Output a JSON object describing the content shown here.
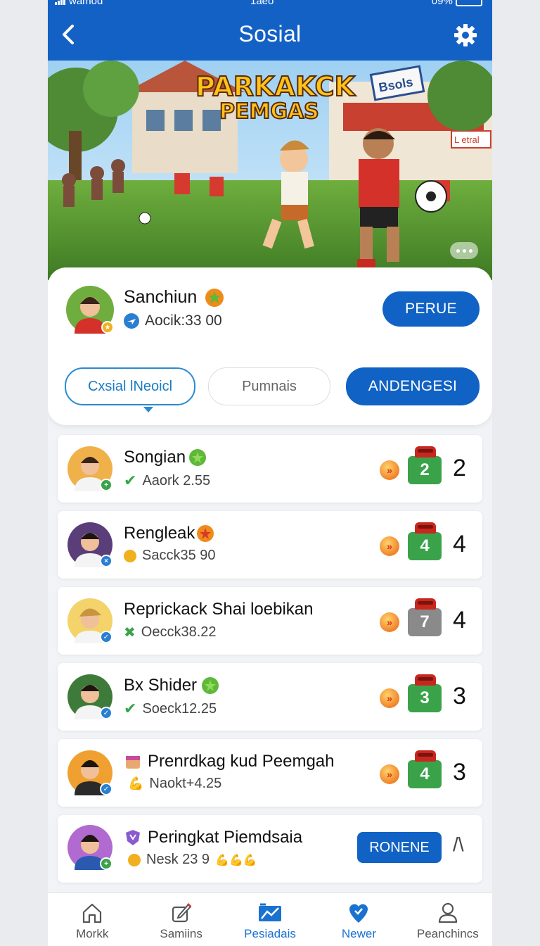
{
  "status_bar": {
    "carrier": "wamod",
    "time": "1aeo",
    "battery": "09%"
  },
  "header": {
    "title": "Sosial"
  },
  "banner": {
    "logo_line1": "PARKAKCK",
    "logo_line2": "PEMGAS",
    "sign_text": "Bsols",
    "side_sign": "L etral"
  },
  "profile": {
    "name": "Sanchiun",
    "sub_label": "Aocik:33 00",
    "action_button": "PERUE"
  },
  "tabs": [
    {
      "label": "Cxsial lNeoicl",
      "state": "selected-outline"
    },
    {
      "label": "Pumnais",
      "state": "default"
    },
    {
      "label": "ANDENGESI",
      "state": "active"
    }
  ],
  "list": [
    {
      "name": "Songian",
      "badge": "green",
      "sub": "Aaork 2.55",
      "sub_icon": "check",
      "score": "2",
      "score_color": "#3aa34a",
      "rank": "2"
    },
    {
      "name": "Rengleak",
      "badge": "orange",
      "sub": "Sacck35 90",
      "sub_icon": "coin",
      "score": "4",
      "score_color": "#3aa34a",
      "rank": "4"
    },
    {
      "name": "Reprickack Shai loebikan",
      "badge": "",
      "sub": "Oecck38.22",
      "sub_icon": "star",
      "score": "7",
      "score_color": "#8a8a8a",
      "rank": "4"
    },
    {
      "name": "Bx Shider",
      "badge": "green",
      "sub": "Soeck12.25",
      "sub_icon": "check",
      "score": "3",
      "score_color": "#3aa34a",
      "rank": "3"
    },
    {
      "name": "Prenrdkag kud Peemgah",
      "badge": "",
      "sub": "Naokt+4.25",
      "sub_icon": "flex",
      "score": "4",
      "score_color": "#3aa34a",
      "rank": "3"
    },
    {
      "name": "Peringkat Piemdsaia",
      "badge": "",
      "sub": "Nesk 23 9",
      "sub_extra": "💪💪💪",
      "sub_icon": "coin",
      "button": "RONENE",
      "rank": "/\\"
    }
  ],
  "bottom_nav": [
    {
      "label": "Morkk",
      "icon": "home-icon"
    },
    {
      "label": "Samiins",
      "icon": "pencil-icon"
    },
    {
      "label": "Pesiadais",
      "icon": "board-icon",
      "active": true
    },
    {
      "label": "Newer",
      "icon": "heart-pin-icon"
    },
    {
      "label": "Peanchincs",
      "icon": "person-icon"
    }
  ],
  "colors": {
    "primary": "#1062c4",
    "header": "#1461c6",
    "green": "#3aa34a"
  }
}
